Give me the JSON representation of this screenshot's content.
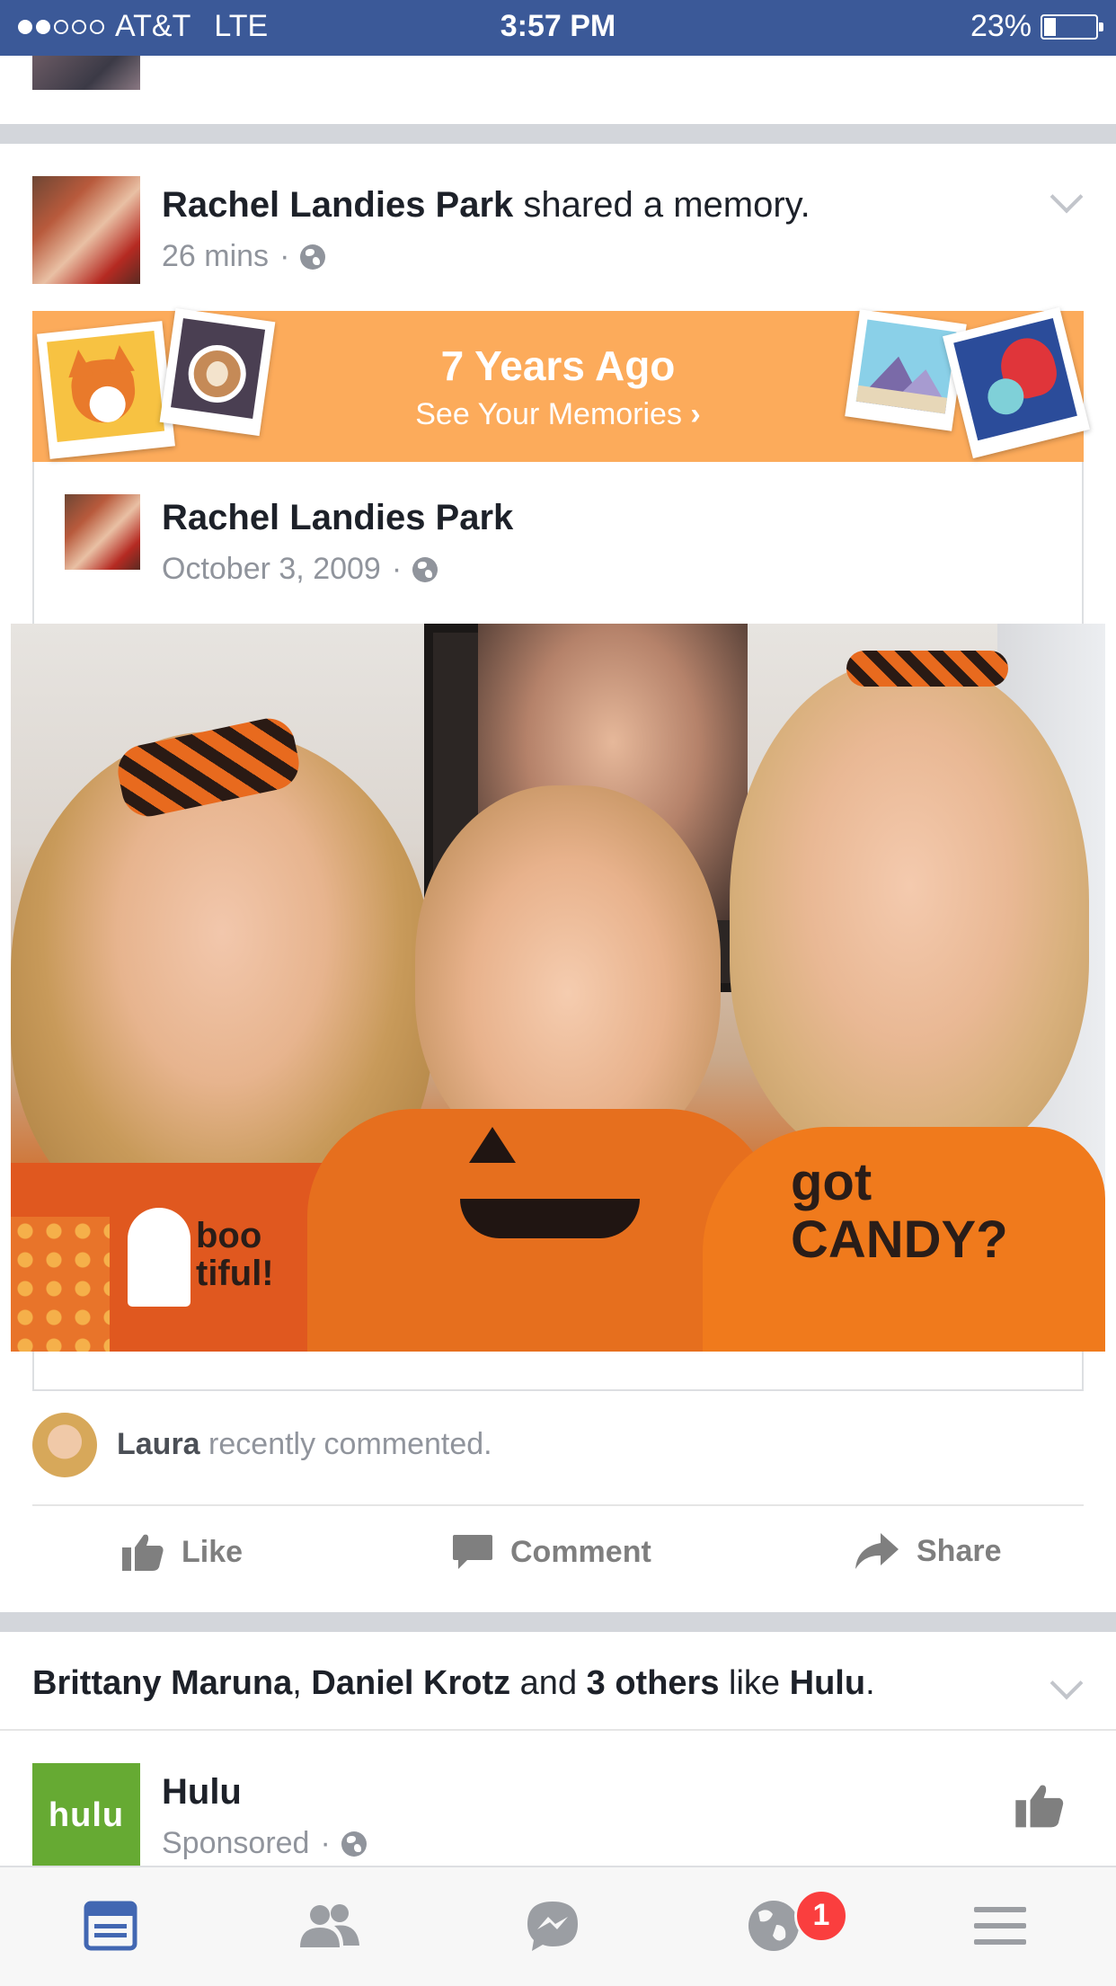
{
  "status_bar": {
    "carrier": "AT&T",
    "network": "LTE",
    "time": "3:57 PM",
    "battery_percent": "23%",
    "battery_level": 0.23,
    "signal_strength_of_5": 2
  },
  "memory_post": {
    "author": "Rachel Landies Park",
    "action": "shared a memory.",
    "time_ago": "26 mins",
    "separator": "·",
    "privacy_icon": "globe-icon",
    "banner": {
      "title": "7 Years Ago",
      "subtitle": "See Your Memories",
      "color": "#fcab5b"
    },
    "original": {
      "author": "Rachel Landies Park",
      "date": "October 3, 2009",
      "separator": "·"
    },
    "photo_shirt_text": {
      "left": "boo tiful!",
      "right": "got CANDY?"
    },
    "recent_comment": {
      "name": "Laura",
      "text": "recently commented."
    },
    "actions": {
      "like": "Like",
      "comment": "Comment",
      "share": "Share"
    }
  },
  "page_like_story": {
    "name1": "Brittany Maruna",
    "comma": ",",
    "name2": "Daniel Krotz",
    "and_text": "and",
    "others": "3 others",
    "like_text": "like",
    "page": "Hulu",
    "period": "."
  },
  "sponsored_post": {
    "logo_text": "hulu",
    "page_name": "Hulu",
    "sponsored_label": "Sponsored",
    "separator": "·",
    "brand_color": "#66aa33"
  },
  "tab_bar": {
    "items": [
      "news-feed-icon",
      "friends-icon",
      "messenger-icon",
      "notifications-globe-icon",
      "menu-icon"
    ],
    "notification_badge": "1",
    "active_color": "#4267b2"
  }
}
